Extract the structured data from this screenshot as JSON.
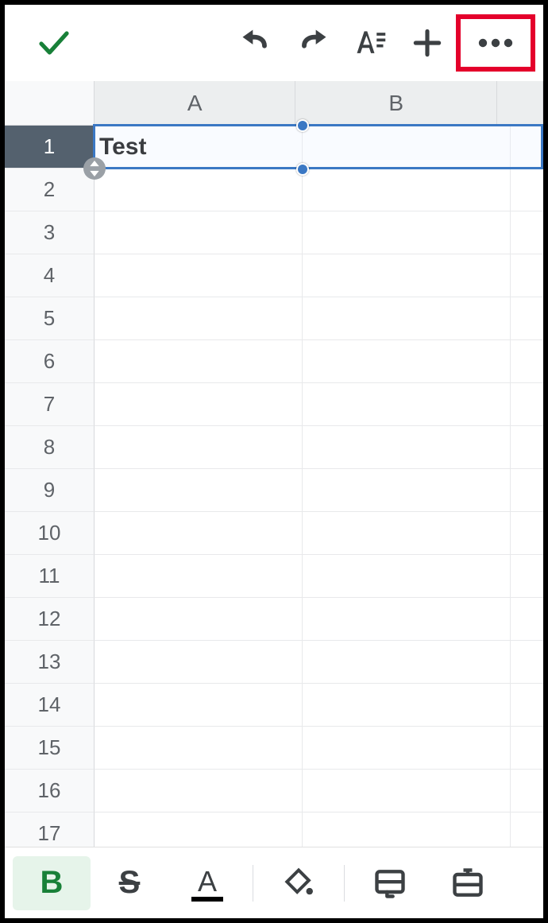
{
  "toolbar": {
    "accept_icon": "check-icon",
    "undo_icon": "undo-icon",
    "redo_icon": "redo-icon",
    "format_icon": "text-format-icon",
    "insert_icon": "plus-icon",
    "more_icon": "more-icon"
  },
  "columns": [
    "A",
    "B"
  ],
  "rows": [
    "1",
    "2",
    "3",
    "4",
    "5",
    "6",
    "7",
    "8",
    "9",
    "10",
    "11",
    "12",
    "13",
    "14",
    "15",
    "16",
    "17"
  ],
  "selected_cell": {
    "row_index": 0,
    "col_index": 0,
    "span_cols": 2
  },
  "cells": {
    "A1": "Test"
  },
  "bottom_toolbar": {
    "bold_label": "B",
    "bold_active": true,
    "strike_label": "S",
    "text_color_label": "A",
    "text_color_underline": "#000000",
    "fill_icon": "fill-color-icon",
    "cell_border_icon": "cell-border-icon",
    "merge_icon": "merge-cells-icon"
  },
  "colors": {
    "accent": "#188038",
    "toolbar_icon": "#3c4043",
    "highlight": "#e4002b",
    "selection_border": "#3b78c4"
  }
}
